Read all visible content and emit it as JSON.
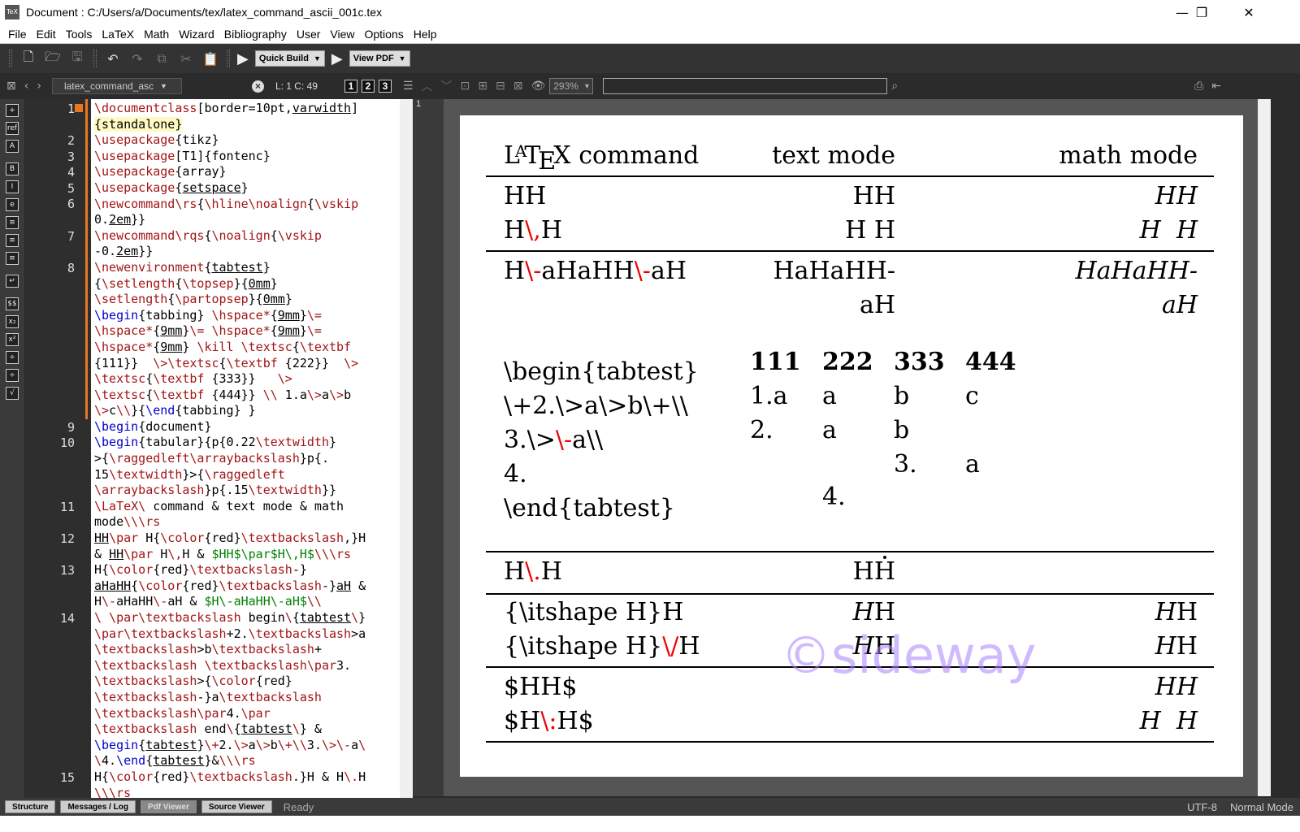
{
  "window": {
    "title": "Document : C:/Users/a/Documents/tex/latex_command_ascii_001c.tex",
    "app_icon_text": "TeX",
    "minimize": "—",
    "maximize": "❐",
    "close": "✕"
  },
  "menu": [
    "File",
    "Edit",
    "Tools",
    "LaTeX",
    "Math",
    "Wizard",
    "Bibliography",
    "User",
    "View",
    "Options",
    "Help"
  ],
  "toolbar": {
    "build_label": "Quick Build",
    "view_label": "View PDF"
  },
  "subbar": {
    "doc_tab": "latex_command_asc",
    "cursor_pos": "L: 1 C: 49",
    "views": [
      "1",
      "2",
      "3"
    ],
    "zoom": "293%"
  },
  "pdf_page_number": "1",
  "line_numbers": [
    "1",
    "2",
    "3",
    "4",
    "5",
    "6",
    "7",
    "8",
    "9",
    "10",
    "11",
    "12",
    "13",
    "14",
    "15"
  ],
  "pdf": {
    "header": {
      "col1_la": "L",
      "col1_a": "A",
      "col1_t": "T",
      "col1_e": "E",
      "col1_x": "X",
      "col1_rest": " command",
      "col2": "text mode",
      "col3": "math mode"
    },
    "r1": {
      "c1": "HH",
      "c2": "HH",
      "c3": "HH"
    },
    "r2": {
      "c1a": "H",
      "c1b": "\\,",
      "c1c": "H",
      "c2": "H H",
      "c3": "H  H"
    },
    "r3": {
      "c1a": "H",
      "c1b": "\\-",
      "c1c": "aHaHH",
      "c1d": "\\-",
      "c1e": "aH",
      "c2a": "HaHaHH-",
      "c2b": "aH",
      "c3a": "HaHaHH-",
      "c3b": "aH"
    },
    "tab": {
      "l1": "\\begin{tabtest}",
      "l2": "\\+2.\\>a\\>b\\+\\\\",
      "l3a": "3.\\>",
      "l3b": "\\-",
      "l3c": "a\\\\",
      "l4": "4.",
      "l5": "\\end{tabtest}",
      "h": [
        "111",
        "222",
        "333",
        "444"
      ],
      "r1": [
        "1.a",
        "a",
        "b",
        "c"
      ],
      "r2": [
        "2.",
        "a",
        "b"
      ],
      "r3": [
        "3.",
        "a"
      ],
      "r4": [
        "4."
      ]
    },
    "r5": {
      "c1a": "H",
      "c1b": "\\.",
      "c1c": "H",
      "c2": "HH"
    },
    "r6": {
      "c1": "{\\itshape H}H",
      "c2a": "H",
      "c2b": "H",
      "c3a": "H",
      "c3b": "H"
    },
    "r7": {
      "c1a": "{\\itshape H}",
      "c1b": "\\/",
      "c1c": "H",
      "c2a": "H",
      "c2b": "H",
      "c3a": "H",
      "c3b": "H"
    },
    "r8": {
      "c1": "$HH$",
      "c3": "HH"
    },
    "r9": {
      "c1a": "$H",
      "c1b": "\\:",
      "c1c": "H$",
      "c3": "H  H"
    },
    "watermark": "©sideway"
  },
  "statusbar": {
    "tabs": [
      "Structure",
      "Messages / Log",
      "Pdf Viewer",
      "Source Viewer"
    ],
    "status": "Ready",
    "encoding": "UTF-8",
    "mode": "Normal Mode"
  }
}
